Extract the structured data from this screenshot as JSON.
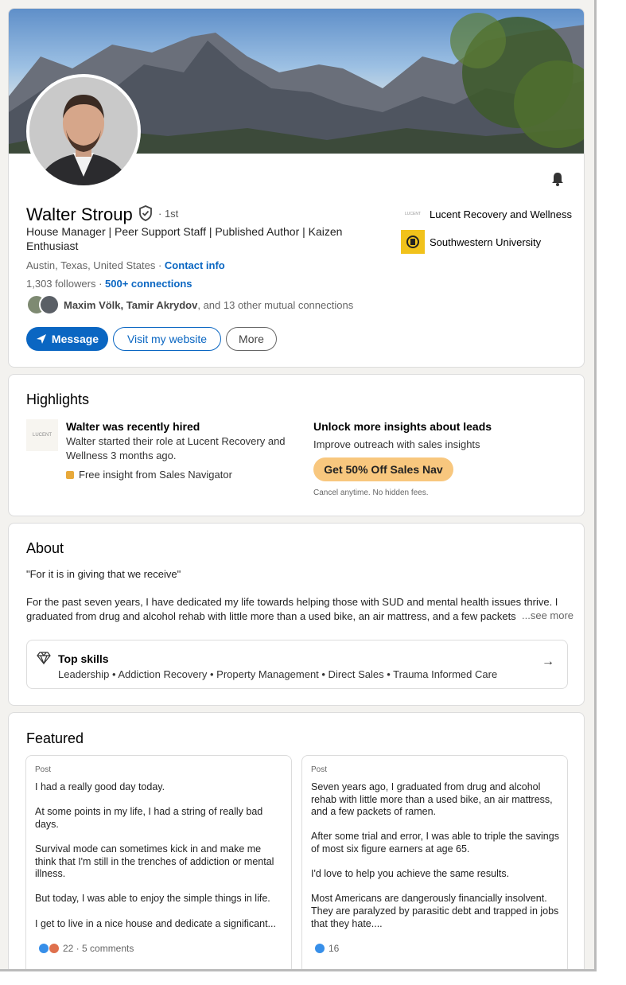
{
  "profile": {
    "name": "Walter Stroup",
    "degree": "· 1st",
    "headline": "House Manager | Peer Support Staff | Published Author | Kaizen Enthusiast",
    "location": "Austin, Texas, United States ·",
    "contact_label": "Contact info",
    "followers": "1,303 followers",
    "connections": "500+ connections",
    "mutual_names": "Maxim Völk, Tamir Akrydov",
    "mutual_rest": ", and 13 other mutual connections",
    "buttons": {
      "message": "Message",
      "website": "Visit my website",
      "more": "More"
    },
    "orgs": [
      {
        "name": "Lucent Recovery and Wellness",
        "logo_text": "LUCENT"
      },
      {
        "name": "Southwestern University"
      }
    ]
  },
  "highlights": {
    "title": "Highlights",
    "logo_text": "LUCENT",
    "hired_title": "Walter was recently hired",
    "hired_desc": "Walter started their role at Lucent Recovery and Wellness 3 months ago.",
    "free_insight": "Free insight from Sales Navigator",
    "insights_title": "Unlock more insights about leads",
    "insights_desc": "Improve outreach with sales insights",
    "insights_button": "Get 50% Off Sales Nav",
    "insights_note": "Cancel anytime. No hidden fees."
  },
  "about": {
    "title": "About",
    "quote": "\"For it is in giving that we receive\"",
    "body": "For the past seven years, I have dedicated my life towards helping those with SUD and mental health issues thrive. I graduated from drug and alcohol rehab with little more than a used bike, an air mattress, and a few packets of",
    "see_more": "...see more",
    "skills_title": "Top skills",
    "skills_list": "Leadership • Addiction Recovery • Property Management • Direct Sales • Trauma Informed Care"
  },
  "featured": {
    "title": "Featured",
    "posts": [
      {
        "type": "Post",
        "body": "I had a really good day today.\n\nAt some points in my life, I had a string of really bad days.\n\nSurvival mode can sometimes kick in and make me think that I'm still in the trenches of addiction or mental illness.\n\nBut today, I was able to enjoy the simple things in life.\n\nI get to live in a nice house and dedicate a significant...",
        "reactions": "22 · 5 comments"
      },
      {
        "type": "Post",
        "body": "Seven years ago, I graduated from drug and alcohol rehab with little more than a used bike, an air mattress, and a few packets of ramen.\n\nAfter some trial and error, I was able to triple the savings of most six figure earners at age 65.\n\nI'd love to help you achieve the same results.\n\nMost Americans are dangerously financially insolvent. They are paralyzed by parasitic debt and trapped in jobs that they hate....",
        "reactions": "16"
      }
    ]
  },
  "colors": {
    "accent": "#0a66c2",
    "premium": "#f8c77e",
    "background": "#f3f2ef"
  }
}
